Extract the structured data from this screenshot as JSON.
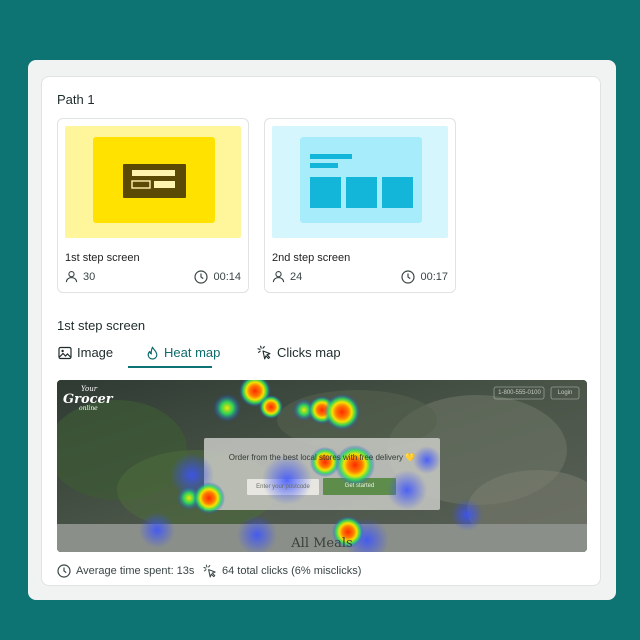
{
  "path": {
    "title": "Path 1"
  },
  "steps": [
    {
      "name": "1st step screen",
      "users": "30",
      "time": "00:14"
    },
    {
      "name": "2nd step screen",
      "users": "24",
      "time": "00:17"
    }
  ],
  "section": {
    "title": "1st step screen"
  },
  "tabs": [
    {
      "label": "Image",
      "icon": "image-icon",
      "active": false
    },
    {
      "label": "Heat map",
      "icon": "flame-icon",
      "active": true
    },
    {
      "label": "Clicks map",
      "icon": "cursor-click-icon",
      "active": false
    }
  ],
  "preview": {
    "logo_line1": "Your",
    "logo_line2": "Grocer",
    "logo_line3": "online",
    "phone": "1-800-555-0100",
    "login": "Login",
    "headline": "Order from the best local stores with free delivery 💛",
    "postcode_placeholder": "Enter your postcode",
    "cta": "Get started",
    "bottom_heading": "All Meals"
  },
  "footer": {
    "avg_time": "Average time spent: 13s",
    "clicks": "64 total clicks (6% misclicks)"
  },
  "colors": {
    "teal": "#0e7373",
    "accent_text": "#0e6b6b",
    "yellow": "#ffe200",
    "cyan": "#a7ecfb"
  }
}
